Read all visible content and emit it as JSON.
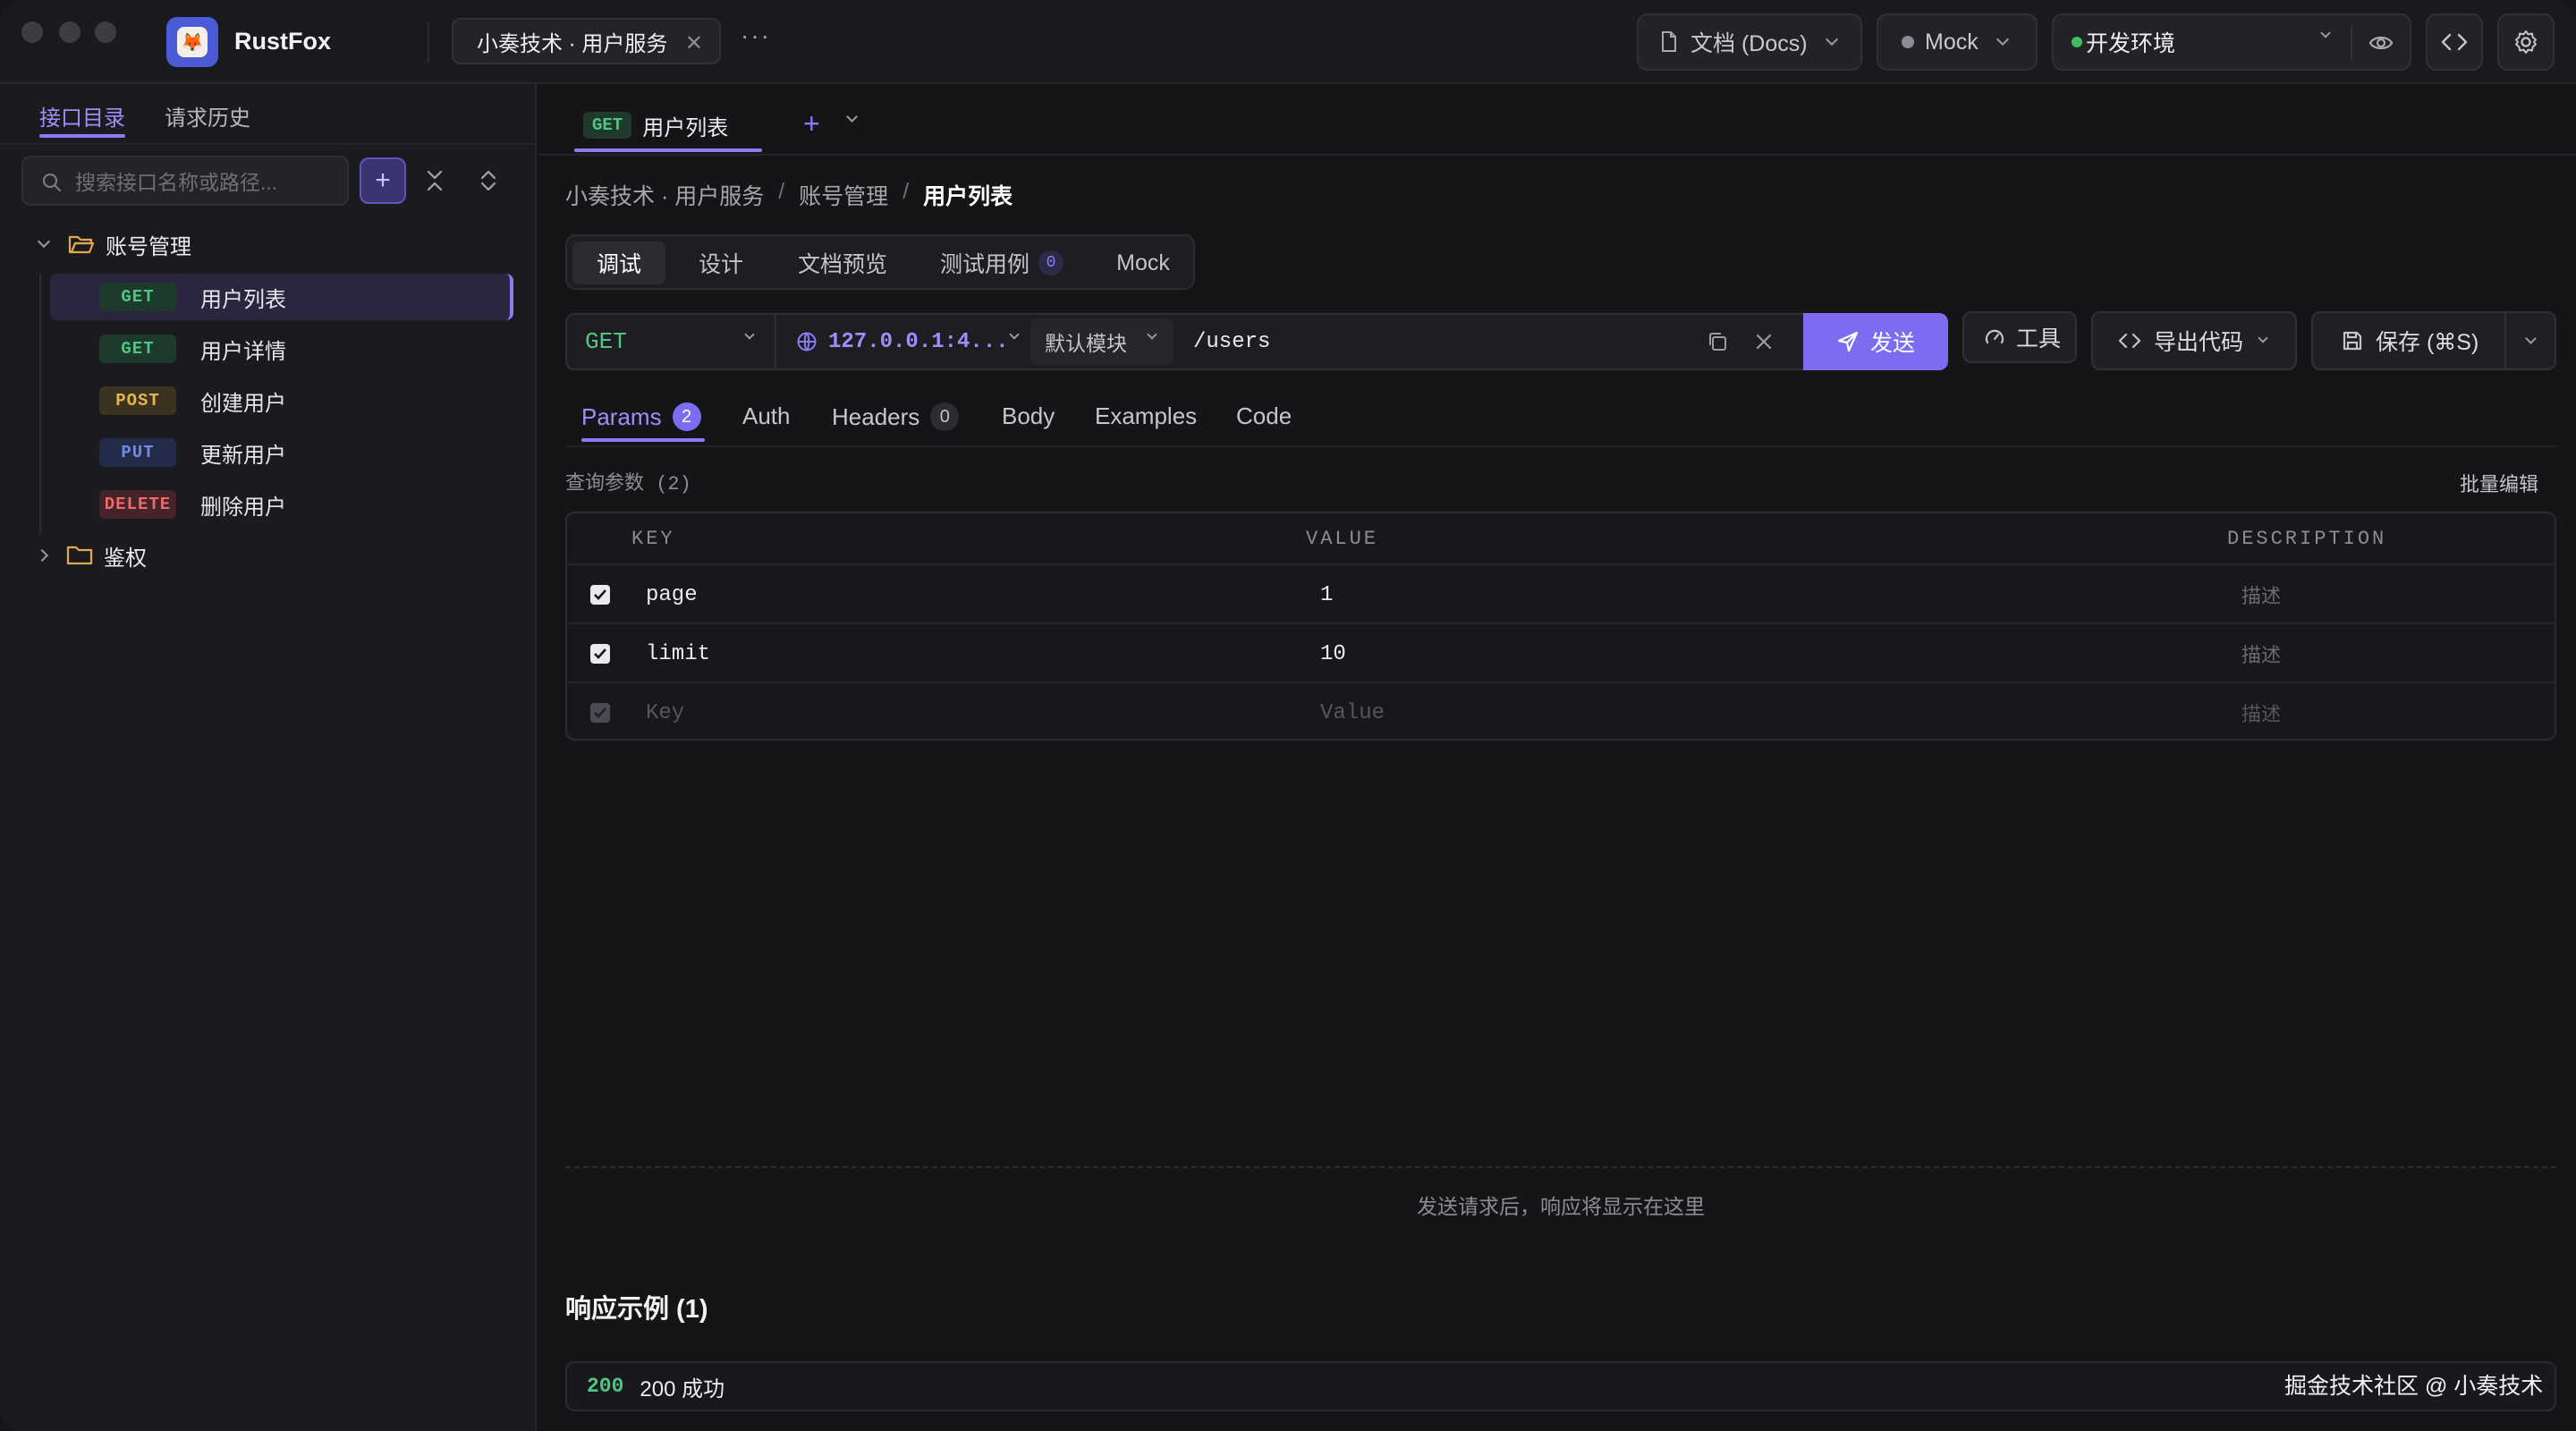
{
  "app": {
    "name": "RustFox"
  },
  "titlebar": {
    "project_tab": "小奏技术 · 用户服务",
    "more": "···",
    "docs_label": "文档 (Docs)",
    "mock_label": "Mock",
    "env_label": "开发环境",
    "env_dot_color": "#3fbf5f"
  },
  "sidebar": {
    "tabs": [
      {
        "label": "接口目录",
        "active": true
      },
      {
        "label": "请求历史",
        "active": false
      }
    ],
    "search_placeholder": "搜索接口名称或路径...",
    "folders": [
      {
        "label": "账号管理",
        "expanded": true
      },
      {
        "label": "鉴权",
        "expanded": false
      }
    ],
    "endpoints": [
      {
        "method": "GET",
        "label": "用户列表",
        "active": true
      },
      {
        "method": "GET",
        "label": "用户详情",
        "active": false
      },
      {
        "method": "POST",
        "label": "创建用户",
        "active": false
      },
      {
        "method": "PUT",
        "label": "更新用户",
        "active": false
      },
      {
        "method": "DELETE",
        "label": "删除用户",
        "active": false
      }
    ]
  },
  "method_colors": {
    "GET": "#4fc784",
    "POST": "#e2b650",
    "PUT": "#6f8de8",
    "DELETE": "#ef6a6a"
  },
  "request_tab": {
    "method": "GET",
    "label": "用户列表"
  },
  "breadcrumb": [
    "小奏技术 · 用户服务",
    "账号管理",
    "用户列表"
  ],
  "breadcrumb_sep": "/",
  "segments": [
    {
      "label": "调试",
      "active": true
    },
    {
      "label": "设计"
    },
    {
      "label": "文档预览"
    },
    {
      "label": "测试用例",
      "count": "0"
    },
    {
      "label": "Mock"
    }
  ],
  "url": {
    "method": "GET",
    "base": "127.0.0.1:4...",
    "module": "默认模块",
    "path": "/users",
    "send_label": "发送"
  },
  "toolbar": {
    "tools": "工具",
    "export": "导出代码",
    "save": "保存 (⌘S)"
  },
  "params_tabs": [
    {
      "label": "Params",
      "count": "2",
      "active": true
    },
    {
      "label": "Auth"
    },
    {
      "label": "Headers",
      "count": "0"
    },
    {
      "label": "Body"
    },
    {
      "label": "Examples"
    },
    {
      "label": "Code"
    }
  ],
  "query": {
    "title": "查询参数 (2)",
    "bulk_edit": "批量编辑"
  },
  "table": {
    "headers": [
      "KEY",
      "VALUE",
      "DESCRIPTION"
    ],
    "rows": [
      {
        "key": "page",
        "value": "1",
        "desc": "描述",
        "checked": true
      },
      {
        "key": "limit",
        "value": "10",
        "desc": "描述",
        "checked": true
      },
      {
        "key": "Key",
        "value": "Value",
        "desc": "描述",
        "checked": true,
        "placeholder": true
      }
    ]
  },
  "response": {
    "hint": "发送请求后，响应将显示在这里",
    "examples_title": "响应示例 (1)",
    "example_code": "200",
    "example_label": "200 成功"
  },
  "watermark": "掘金技术社区 @ 小奏技术"
}
